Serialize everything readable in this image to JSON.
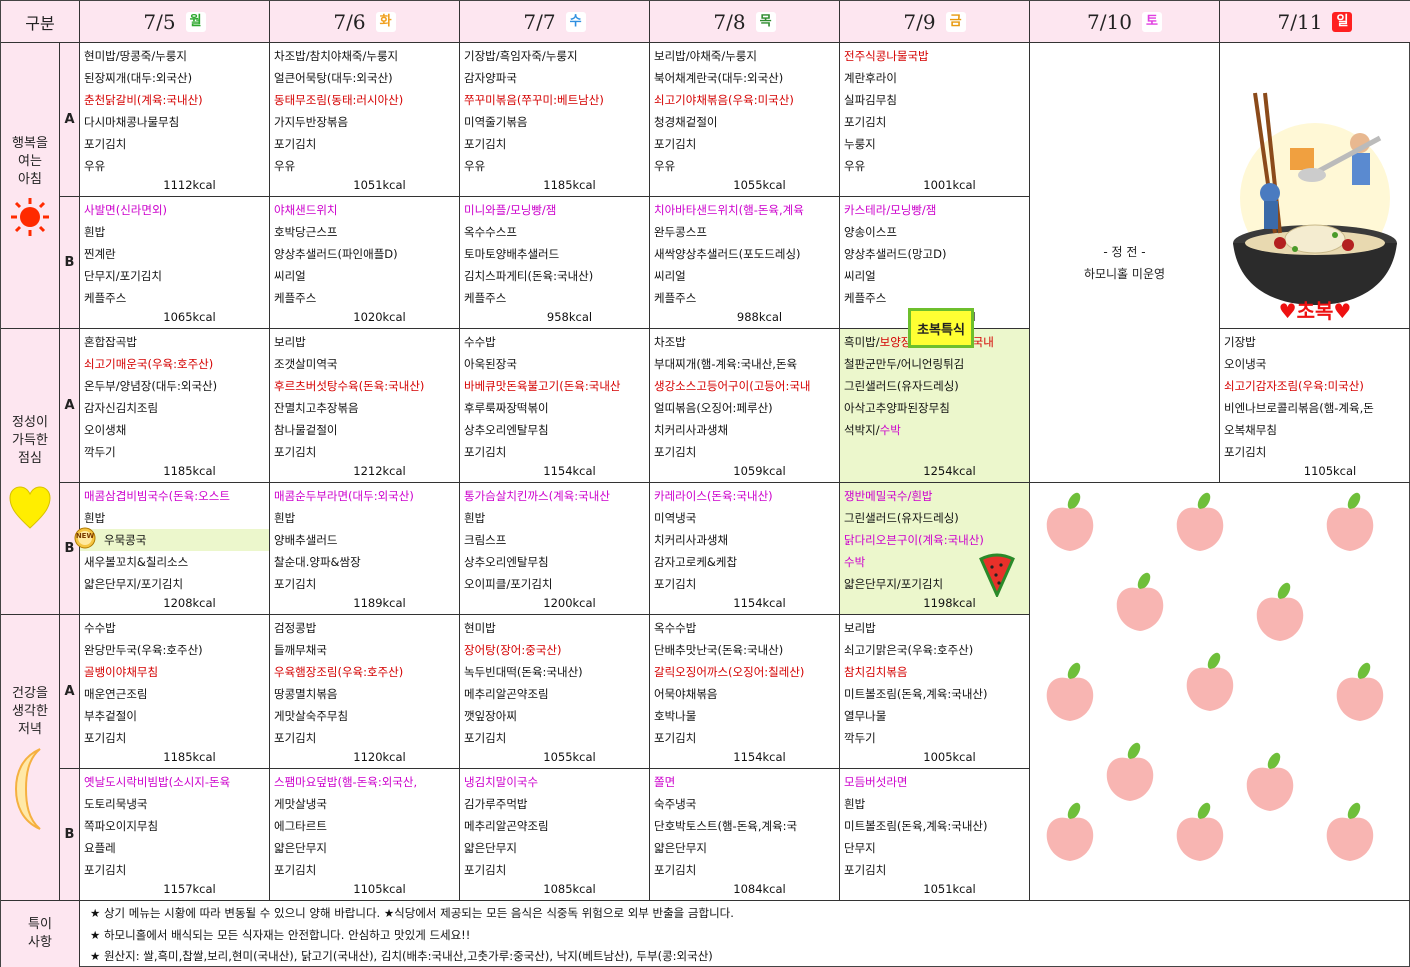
{
  "header": {
    "gubun": "구분",
    "days": [
      {
        "date": "7/5",
        "weekday": "월",
        "badge_color": "#2ea82e"
      },
      {
        "date": "7/6",
        "weekday": "화",
        "badge_color": "#f0a020"
      },
      {
        "date": "7/7",
        "weekday": "수",
        "badge_color": "#2f8fe0"
      },
      {
        "date": "7/8",
        "weekday": "목",
        "badge_color": "#2e8b2e"
      },
      {
        "date": "7/9",
        "weekday": "금",
        "badge_color": "#e89a10"
      },
      {
        "date": "7/10",
        "weekday": "토",
        "badge_color": "#e040e0"
      },
      {
        "date": "7/11",
        "weekday": "일",
        "badge_color": "#e02020"
      }
    ]
  },
  "meals": {
    "breakfast": {
      "lines": [
        "행복을",
        "여는",
        "아침"
      ]
    },
    "lunch": {
      "lines": [
        "정성이",
        "가득한",
        "점심"
      ]
    },
    "dinner": {
      "lines": [
        "건강을",
        "생각한",
        "저녁"
      ]
    },
    "notes": {
      "lines": [
        "특이",
        "사항"
      ]
    }
  },
  "ab": {
    "a": "A",
    "b": "B"
  },
  "menus": {
    "breakfast_a": [
      {
        "items": [
          {
            "t": "현미밥/땅콩죽/누룽지"
          },
          {
            "t": "된장찌개(대두:외국산)"
          },
          {
            "t": "춘천닭갈비(계육:국내산)",
            "c": "red"
          },
          {
            "t": "다시마채콩나물무침"
          },
          {
            "t": "포기김치"
          },
          {
            "t": "우유"
          }
        ],
        "kcal": "1112kcal"
      },
      {
        "items": [
          {
            "t": "차조밥/참치야채죽/누룽지"
          },
          {
            "t": "얼큰어묵탕(대두:외국산)"
          },
          {
            "t": "동태무조림(동태:러시아산)",
            "c": "red"
          },
          {
            "t": "가지두반장볶음"
          },
          {
            "t": "포기김치"
          },
          {
            "t": "우유"
          }
        ],
        "kcal": "1051kcal"
      },
      {
        "items": [
          {
            "t": "기장밥/흑임자죽/누룽지"
          },
          {
            "t": "감자양파국"
          },
          {
            "t": "쭈꾸미볶음(쭈꾸미:베트남산)",
            "c": "red"
          },
          {
            "t": "미역줄기볶음"
          },
          {
            "t": "포기김치"
          },
          {
            "t": "우유"
          }
        ],
        "kcal": "1185kcal"
      },
      {
        "items": [
          {
            "t": "보리밥/야채죽/누룽지"
          },
          {
            "t": "북어채계란국(대두:외국산)"
          },
          {
            "t": "쇠고기야채볶음(우육:미국산)",
            "c": "red"
          },
          {
            "t": "청경채겉절이"
          },
          {
            "t": "포기김치"
          },
          {
            "t": "우유"
          }
        ],
        "kcal": "1055kcal"
      },
      {
        "items": [
          {
            "t": "전주식콩나물국밥",
            "c": "red"
          },
          {
            "t": "계란후라이"
          },
          {
            "t": "실파김무침"
          },
          {
            "t": "포기김치"
          },
          {
            "t": "누룽지"
          },
          {
            "t": "우유"
          }
        ],
        "kcal": "1001kcal"
      }
    ],
    "breakfast_b": [
      {
        "items": [
          {
            "t": "사발면(신라면외)",
            "c": "pink"
          },
          {
            "t": "흰밥"
          },
          {
            "t": "찐계란"
          },
          {
            "t": "단무지/포기김치"
          },
          {
            "t": "케플주스"
          }
        ],
        "kcal": "1065kcal"
      },
      {
        "items": [
          {
            "t": "야채샌드위치",
            "c": "pink"
          },
          {
            "t": "호박당근스프"
          },
          {
            "t": "양상추샐러드(파인애플D)"
          },
          {
            "t": "씨리얼"
          },
          {
            "t": "케플주스"
          }
        ],
        "kcal": "1020kcal"
      },
      {
        "items": [
          {
            "t": "미니와플/모닝빵/잼",
            "c": "pink"
          },
          {
            "t": "옥수수스프"
          },
          {
            "t": "토마토양배추샐러드"
          },
          {
            "t": "김치스파게티(돈육:국내산)"
          },
          {
            "t": "케플주스"
          }
        ],
        "kcal": "958kcal"
      },
      {
        "items": [
          {
            "t": "치아바타샌드위치(햄-돈육,계육",
            "c": "pink"
          },
          {
            "t": "완두콩스프"
          },
          {
            "t": "새싹양상추샐러드(포도드레싱)"
          },
          {
            "t": "씨리얼"
          },
          {
            "t": "케플주스"
          }
        ],
        "kcal": "988kcal"
      },
      {
        "items": [
          {
            "t": "카스테라/모닝빵/잼",
            "c": "pink"
          },
          {
            "t": "양송이스프"
          },
          {
            "t": "양상추샐러드(망고D)"
          },
          {
            "t": "씨리얼"
          },
          {
            "t": "케플주스"
          }
        ],
        "kcal": "1001kcal"
      }
    ],
    "lunch_a": [
      {
        "items": [
          {
            "t": "혼합잡곡밥"
          },
          {
            "t": "쇠고기매운국(우육:호주산)",
            "c": "red"
          },
          {
            "t": "온두부/양념장(대두:외국산)"
          },
          {
            "t": "감자신김치조림"
          },
          {
            "t": "오이생채"
          },
          {
            "t": "깍두기"
          }
        ],
        "kcal": "1185kcal"
      },
      {
        "items": [
          {
            "t": "보리밥"
          },
          {
            "t": "조갯살미역국"
          },
          {
            "t": "후르츠버섯탕수육(돈육:국내산)",
            "c": "red"
          },
          {
            "t": "잔멸치고추장볶음"
          },
          {
            "t": "참나물겉절이"
          },
          {
            "t": "포기김치"
          }
        ],
        "kcal": "1212kcal"
      },
      {
        "items": [
          {
            "t": "수수밥"
          },
          {
            "t": "아욱된장국"
          },
          {
            "t": "바베큐맛돈육불고기(돈육:국내산",
            "c": "red"
          },
          {
            "t": "후루룩짜장떡볶이"
          },
          {
            "t": "상추오리엔탈무침"
          },
          {
            "t": "포기김치"
          }
        ],
        "kcal": "1154kcal"
      },
      {
        "items": [
          {
            "t": "차조밥"
          },
          {
            "t": "부대찌개(햄-계육:국내산,돈육"
          },
          {
            "t": "생강소스고등어구이(고등어:국내",
            "c": "red"
          },
          {
            "t": "얼띠볶음(오징어:페루산)"
          },
          {
            "t": "치커리사과생채"
          },
          {
            "t": "포기김치"
          }
        ],
        "kcal": "1059kcal"
      },
      {
        "items": [
          {
            "t": "흑미밥/",
            "s": "보양장각백숙(계육:국내",
            "sc": "red"
          },
          {
            "t": "철판군만두/어니언링튀김"
          },
          {
            "t": "그린샐러드(유자드레싱)"
          },
          {
            "t": "아삭고추양파된장무침"
          },
          {
            "t": "석박지/",
            "s": "수박",
            "sc": "pink"
          }
        ],
        "kcal": "1254kcal"
      },
      {
        "items": [],
        "kcal": ""
      },
      {
        "items": [
          {
            "t": "기장밥"
          },
          {
            "t": "오이냉국"
          },
          {
            "t": "쇠고기감자조림(우육:미국산)",
            "c": "red"
          },
          {
            "t": "비엔나브로콜리볶음(햄-계육,돈"
          },
          {
            "t": "오복채무침"
          },
          {
            "t": "포기김치"
          }
        ],
        "kcal": "1105kcal"
      }
    ],
    "lunch_b": [
      {
        "items": [
          {
            "t": "매콤삼겹비빔국수(돈육:오스트",
            "c": "pink"
          },
          {
            "t": "흰밥"
          },
          {
            "t": "우묵콩국",
            "hl": true
          },
          {
            "t": "새우볼꼬치&칠리소스"
          },
          {
            "t": "얇은단무지/포기김치"
          }
        ],
        "kcal": "1208kcal",
        "new_badge": "NEW"
      },
      {
        "items": [
          {
            "t": "매콤순두부라면(대두:외국산)",
            "c": "pink"
          },
          {
            "t": "흰밥"
          },
          {
            "t": "양배추샐러드"
          },
          {
            "t": "찰순대.양파&쌈장"
          },
          {
            "t": "포기김치"
          }
        ],
        "kcal": "1189kcal"
      },
      {
        "items": [
          {
            "t": "통가슴살치킨까스(계육:국내산",
            "c": "pink"
          },
          {
            "t": "흰밥"
          },
          {
            "t": "크림스프"
          },
          {
            "t": "상추오리엔탈무침"
          },
          {
            "t": "오이피클/포기김치"
          }
        ],
        "kcal": "1200kcal"
      },
      {
        "items": [
          {
            "t": "카레라이스(돈육:국내산)",
            "c": "pink"
          },
          {
            "t": "미역냉국"
          },
          {
            "t": "치커리사과생채"
          },
          {
            "t": "감자고로케&케찹"
          },
          {
            "t": "포기김치"
          }
        ],
        "kcal": "1154kcal"
      },
      {
        "items": [
          {
            "t": "쟁반메밀국수/흰밥",
            "c": "pink"
          },
          {
            "t": "그린샐러드(유자드레싱)"
          },
          {
            "t": "닭다리오븐구이(계육:국내산)",
            "c": "pink"
          },
          {
            "t": "수박",
            "c": "pink"
          },
          {
            "t": "얇은단무지/포기김치"
          }
        ],
        "kcal": "1198kcal"
      }
    ],
    "dinner_a": [
      {
        "items": [
          {
            "t": "수수밥"
          },
          {
            "t": "완당만두국(우육:호주산)"
          },
          {
            "t": "골뱅이야채무침",
            "c": "red"
          },
          {
            "t": "매운연근조림"
          },
          {
            "t": "부추겉절이"
          },
          {
            "t": "포기김치"
          }
        ],
        "kcal": "1185kcal"
      },
      {
        "items": [
          {
            "t": "검정콩밥"
          },
          {
            "t": "들깨무채국"
          },
          {
            "t": "우육햄장조림(우육:호주산)",
            "c": "red"
          },
          {
            "t": "땅콩멸치볶음"
          },
          {
            "t": "게맛살숙주무침"
          },
          {
            "t": "포기김치"
          }
        ],
        "kcal": "1120kcal"
      },
      {
        "items": [
          {
            "t": "현미밥"
          },
          {
            "t": "장어탕(장어:중국산)",
            "c": "red"
          },
          {
            "t": "녹두빈대떡(돈육:국내산)"
          },
          {
            "t": "메추리알곤약조림"
          },
          {
            "t": "깻잎장아찌"
          },
          {
            "t": "포기김치"
          }
        ],
        "kcal": "1055kcal"
      },
      {
        "items": [
          {
            "t": "옥수수밥"
          },
          {
            "t": "단배추맛난국(돈육:국내산)"
          },
          {
            "t": "갈릭오징어까스(오징어:칠레산)",
            "c": "red"
          },
          {
            "t": "어묵야채볶음"
          },
          {
            "t": "호박나물"
          },
          {
            "t": "포기김치"
          }
        ],
        "kcal": "1154kcal"
      },
      {
        "items": [
          {
            "t": "보리밥"
          },
          {
            "t": "쇠고기맑은국(우육:호주산)"
          },
          {
            "t": "참치김치볶음",
            "c": "red"
          },
          {
            "t": "미트볼조림(돈육,계육:국내산)"
          },
          {
            "t": "열무나물"
          },
          {
            "t": "깍두기"
          }
        ],
        "kcal": "1005kcal"
      }
    ],
    "dinner_b": [
      {
        "items": [
          {
            "t": "옛날도시락비빔밥(소시지-돈육",
            "c": "pink"
          },
          {
            "t": "도토리묵냉국"
          },
          {
            "t": "쪽파오이지무침"
          },
          {
            "t": "요플레"
          },
          {
            "t": "포기김치"
          }
        ],
        "kcal": "1157kcal"
      },
      {
        "items": [
          {
            "t": "스팸마요덮밥(햄-돈육:외국산,",
            "c": "pink"
          },
          {
            "t": "게맛살냉국"
          },
          {
            "t": "에그타르트"
          },
          {
            "t": "얇은단무지"
          },
          {
            "t": "포기김치"
          }
        ],
        "kcal": "1105kcal"
      },
      {
        "items": [
          {
            "t": "냉김치말이국수",
            "c": "pink"
          },
          {
            "t": "김가루주먹밥"
          },
          {
            "t": "메추리알곤약조림"
          },
          {
            "t": "얇은단무지"
          },
          {
            "t": "포기김치"
          }
        ],
        "kcal": "1085kcal"
      },
      {
        "items": [
          {
            "t": "쫄면",
            "c": "pink"
          },
          {
            "t": "숙주냉국"
          },
          {
            "t": "단호박토스트(햄-돈육,계육:국"
          },
          {
            "t": "얇은단무지"
          },
          {
            "t": "포기김치"
          }
        ],
        "kcal": "1084kcal"
      },
      {
        "items": [
          {
            "t": "모듬버섯라면",
            "c": "pink"
          },
          {
            "t": "흰밥"
          },
          {
            "t": "미트볼조림(돈육,계육:국내산)"
          },
          {
            "t": "단무지"
          },
          {
            "t": "포기김치"
          }
        ],
        "kcal": "1051kcal"
      }
    ]
  },
  "closed_notice": {
    "line1": "- 정 전 -",
    "line2": "하모니홀 미운영"
  },
  "special_tag": "초복특식",
  "chobok_label": "♥초복♥",
  "notes_lines": [
    "★ 상기 메뉴는 시황에 따라 변동될 수 있으니 양해 바랍니다. ★식당에서 제공되는 모든 음식은 식중독 위험으로 외부 반출을 금합니다.",
    "★ 하모니홀에서 배식되는 모든 식자재는 안전합니다. 안심하고 맛있게 드세요!!",
    "★ 원산지: 쌀,흑미,찹쌀,보리,현미(국내산), 닭고기(국내산), 김치(배추:국내산,고춧가루:중국산), 낙지(베트남산), 두부(콩:외국산)"
  ]
}
